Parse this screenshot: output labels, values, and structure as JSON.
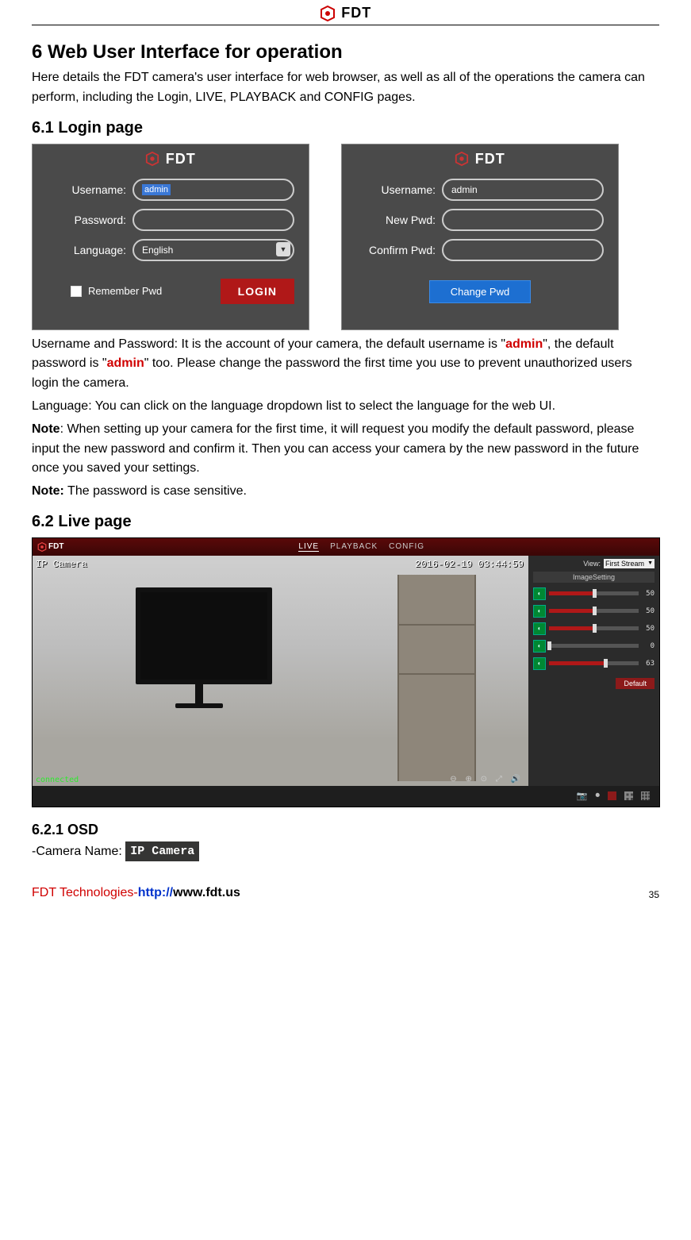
{
  "brand": "FDT",
  "heading1": "6 Web User Interface for operation",
  "intro": "Here details the FDT camera's user interface for web browser, as well as all of the operations the camera can perform, including the Login, LIVE, PLAYBACK and CONFIG pages.",
  "heading2": "6.1 Login page",
  "login_panel": {
    "username_label": "Username:",
    "password_label": "Password:",
    "language_label": "Language:",
    "username_value": "admin",
    "language_value": "English",
    "remember_label": "Remember Pwd",
    "login_button": "LOGIN"
  },
  "change_panel": {
    "username_label": "Username:",
    "new_pwd_label": "New Pwd:",
    "confirm_pwd_label": "Confirm Pwd:",
    "username_value": "admin",
    "change_button": "Change Pwd"
  },
  "para_user_pwd_a": "Username and Password: It is the account of your camera, the default username is \"",
  "para_user_pwd_b": "\", the default password is \"",
  "para_user_pwd_c": "\" too. Please change the password the first time you use to prevent unauthorized users login the camera.",
  "default_cred": "admin",
  "para_lang": "Language: You can click on the language dropdown list to select the language for the web UI.",
  "note1_label": "Note",
  "note1_text": ": When setting up your camera for the first time, it will request you modify the default password, please input the new password and confirm it. Then you can access your camera by the new password in the future once you saved your settings.",
  "note2_label": "Note:",
  "note2_text": " The password is case sensitive.",
  "heading3": "6.2 Live page",
  "live": {
    "tabs": [
      "LIVE",
      "PLAYBACK",
      "CONFIG"
    ],
    "osd_name": "IP Camera",
    "osd_time": "2016-02-19 03:44:59",
    "connected": "connected",
    "view_label": "View:",
    "view_value": "First Stream",
    "image_setting": "ImageSetting",
    "sliders": [
      50,
      50,
      50,
      0,
      63
    ],
    "default_btn": "Default"
  },
  "heading4": "6.2.1 OSD",
  "osd_line_label": "-Camera Name:  ",
  "osd_tag": "IP Camera",
  "footer_company": "FDT Technologies-",
  "footer_url_prefix": "http://",
  "footer_url": "www.fdt.us",
  "page_number": "35"
}
